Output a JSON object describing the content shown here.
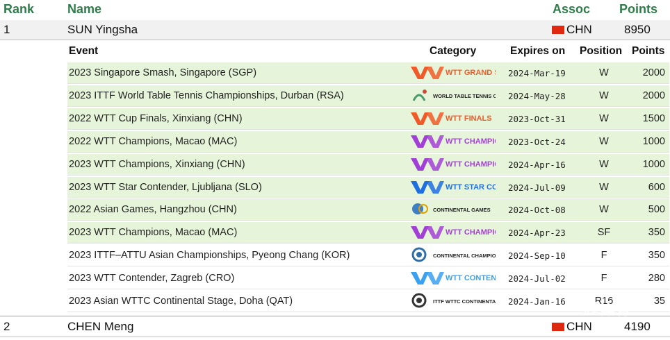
{
  "headers": {
    "rank": "Rank",
    "name": "Name",
    "assoc": "Assoc",
    "points": "Points"
  },
  "players": [
    {
      "rank": "1",
      "name": "SUN Yingsha",
      "assoc": "CHN",
      "points": "8950"
    },
    {
      "rank": "2",
      "name": "CHEN Meng",
      "assoc": "CHN",
      "points": "4190"
    }
  ],
  "event_headers": {
    "event": "Event",
    "category": "Category",
    "expires": "Expires on",
    "position": "Position",
    "points": "Points"
  },
  "events": [
    {
      "event": "2023 Singapore Smash, Singapore (SGP)",
      "logo_text": "WTT GRAND SMASH",
      "logo": "wtt-grand-smash-logo",
      "expires": "2024-Mar-19",
      "position": "W",
      "points": "2000",
      "highlight": true
    },
    {
      "event": "2023 ITTF World Table Tennis Championships, Durban (RSA)",
      "logo_text": "WORLD TABLE TENNIS CHAMPIONSHIPS",
      "logo": "ittf-world-championships-logo",
      "expires": "2024-May-28",
      "position": "W",
      "points": "2000",
      "highlight": true
    },
    {
      "event": "2022 WTT Cup Finals, Xinxiang (CHN)",
      "logo_text": "WTT FINALS",
      "logo": "wtt-finals-logo",
      "expires": "2023-Oct-31",
      "position": "W",
      "points": "1500",
      "highlight": true
    },
    {
      "event": "2022 WTT Champions, Macao (MAC)",
      "logo_text": "WTT CHAMPIONS",
      "logo": "wtt-champions-logo",
      "expires": "2023-Oct-24",
      "position": "W",
      "points": "1000",
      "highlight": true
    },
    {
      "event": "2023 WTT Champions, Xinxiang (CHN)",
      "logo_text": "WTT CHAMPIONS",
      "logo": "wtt-champions-logo",
      "expires": "2024-Apr-16",
      "position": "W",
      "points": "1000",
      "highlight": true
    },
    {
      "event": "2023 WTT Star Contender, Ljubljana (SLO)",
      "logo_text": "WTT STAR CONTENDER",
      "logo": "wtt-star-contender-logo",
      "expires": "2024-Jul-09",
      "position": "W",
      "points": "600",
      "highlight": true
    },
    {
      "event": "2022 Asian Games, Hangzhou (CHN)",
      "logo_text": "CONTINENTAL GAMES",
      "logo": "continental-games-logo",
      "expires": "2024-Oct-08",
      "position": "W",
      "points": "500",
      "highlight": true
    },
    {
      "event": "2023 WTT Champions, Macao (MAC)",
      "logo_text": "WTT CHAMPIONS",
      "logo": "wtt-champions-logo",
      "expires": "2024-Apr-23",
      "position": "SF",
      "points": "350",
      "highlight": true
    },
    {
      "event": "2023 ITTF–ATTU Asian Championships, Pyeong Chang (KOR)",
      "logo_text": "CONTINENTAL CHAMPIONSHIPS",
      "logo": "continental-championships-logo",
      "expires": "2024-Sep-10",
      "position": "F",
      "points": "350",
      "highlight": false
    },
    {
      "event": "2023 WTT Contender, Zagreb (CRO)",
      "logo_text": "WTT CONTENDER",
      "logo": "wtt-contender-logo",
      "expires": "2024-Jul-02",
      "position": "F",
      "points": "280",
      "highlight": false
    },
    {
      "event": "2023 Asian WTTC Continental Stage, Doha (QAT)",
      "logo_text": "ITTF WTTC CONTINENTAL STAGE",
      "logo": "wttc-continental-stage-logo",
      "expires": "2024-Jan-16",
      "position": "R16",
      "points": "35",
      "highlight": false
    }
  ],
  "watermark": "冠体育",
  "colors": {
    "header_green": "#2e7d4a",
    "row_highlight": "#e6f5d9",
    "wtt_orange": "#f05a28",
    "wtt_purple": "#a23fd6",
    "wtt_blue": "#1e6fe0",
    "wtt_light_blue": "#3aa0f0",
    "flag_red": "#de2910"
  }
}
